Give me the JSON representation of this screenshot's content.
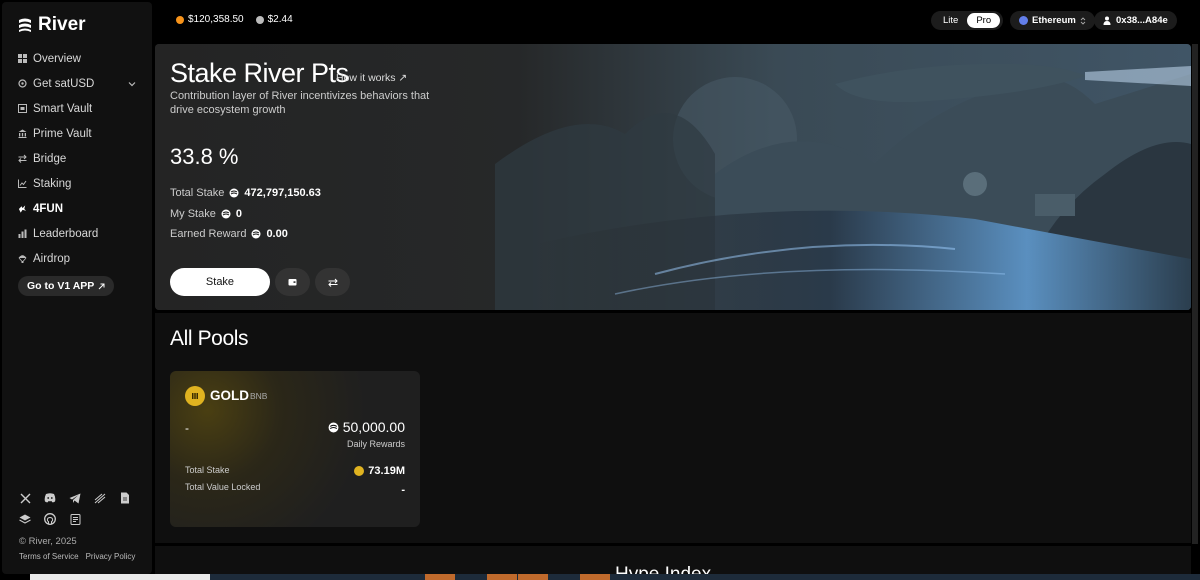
{
  "brand": {
    "name": "River"
  },
  "sidebar": {
    "items": [
      {
        "label": "Overview",
        "icon": "grid-icon"
      },
      {
        "label": "Get satUSD",
        "icon": "circle-icon"
      },
      {
        "label": "Smart Vault",
        "icon": "vault-icon"
      },
      {
        "label": "Prime Vault",
        "icon": "bank-icon"
      },
      {
        "label": "Bridge",
        "icon": "bridge-icon"
      },
      {
        "label": "Staking",
        "icon": "chart-line-icon"
      },
      {
        "label": "4FUN",
        "icon": "fun-icon"
      },
      {
        "label": "Leaderboard",
        "icon": "bar-chart-icon"
      },
      {
        "label": "Airdrop",
        "icon": "airdrop-icon"
      }
    ],
    "active_item": "4FUN",
    "v1_button": "Go to V1 APP",
    "copyright": "© River, 2025",
    "terms": "Terms of Service",
    "privacy": "Privacy Policy"
  },
  "topbar": {
    "btc_price": "$120,358.50",
    "river_price": "$2.44",
    "mode_lite": "Lite",
    "mode_pro": "Pro",
    "mode_selected": "Pro",
    "network": "Ethereum",
    "wallet": "0x38...A84e"
  },
  "hero": {
    "title": "Stake River Pts",
    "how_it_works": "How it works ↗",
    "description": "Contribution layer of River incentivizes behaviors that drive ecosystem growth",
    "apy": "33.8 %",
    "total_stake_label": "Total Stake",
    "total_stake_value": "472,797,150.63",
    "my_stake_label": "My Stake",
    "my_stake_value": "0",
    "earned_reward_label": "Earned Reward",
    "earned_reward_value": "0.00",
    "stake_button": "Stake"
  },
  "pools": {
    "title": "All Pools",
    "cards": [
      {
        "name": "GOLD",
        "chain": "BNB",
        "left_value": "-",
        "daily_rewards_amount": "50,000.00",
        "daily_rewards_label": "Daily Rewards",
        "total_stake_label": "Total Stake",
        "total_stake_value": "73.19M",
        "tvl_label": "Total Value Locked",
        "tvl_value": "-"
      }
    ]
  },
  "next_section": {
    "title": "Hype Index"
  },
  "colors": {
    "gold": "#e0b320",
    "btc": "#f7931a",
    "accent_white": "#ffffff"
  }
}
